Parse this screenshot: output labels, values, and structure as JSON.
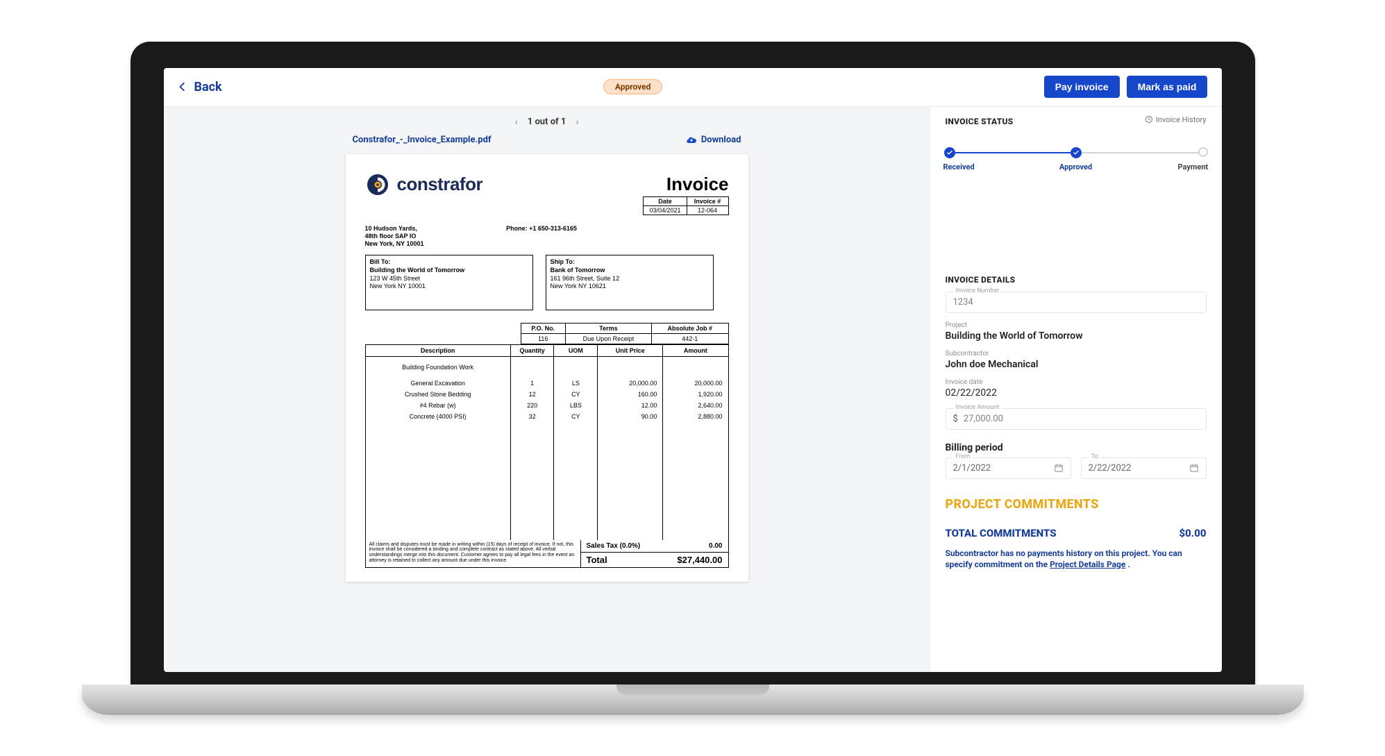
{
  "topbar": {
    "back_label": "Back",
    "status_pill": "Approved",
    "pay_label": "Pay invoice",
    "mark_paid_label": "Mark as paid"
  },
  "viewer": {
    "page_indicator": "1 out of 1",
    "file_name": "Constrafor_-_Invoice_Example.pdf",
    "download_label": "Download"
  },
  "invoice_doc": {
    "brand_name": "constrafor",
    "title": "Invoice",
    "meta": {
      "date_h": "Date",
      "invno_h": "Invoice #",
      "date": "03/04/2021",
      "invno": "12-064"
    },
    "company": {
      "line1": "10 Hudson Yards,",
      "line2": "48th floor SAP IO",
      "line3": "New York, NY 10001",
      "phone_label": "Phone: +1 650-313-6165"
    },
    "bill_to": {
      "h": "Bill To:",
      "line1": "Building the World of Tomorrow",
      "line2": "123 W 45th Street",
      "line3": "New York NY 10001"
    },
    "ship_to": {
      "h": "Ship To:",
      "line1": "Bank of Tomorrow",
      "line2": "161 96th Street, Suite 12",
      "line3": "New York NY 10621"
    },
    "po": {
      "po_h": "P.O. No.",
      "terms_h": "Terms",
      "job_h": "Absolute Job #",
      "po": "116",
      "terms": "Due Upon Receipt",
      "job": "442-1"
    },
    "cols": {
      "desc": "Description",
      "qty": "Quantity",
      "uom": "UOM",
      "unit": "Unit Price",
      "amount": "Amount"
    },
    "heading_line": "Building Foundation Work",
    "lines": [
      {
        "desc": "General Excavation",
        "qty": "1",
        "uom": "LS",
        "unit": "20,000.00",
        "amount": "20,000.00"
      },
      {
        "desc": "Crushed Stone Bedding",
        "qty": "12",
        "uom": "CY",
        "unit": "160.00",
        "amount": "1,920.00"
      },
      {
        "desc": "#4 Rebar (w)",
        "qty": "220",
        "uom": "LBS",
        "unit": "12.00",
        "amount": "2,640.00"
      },
      {
        "desc": "Concrete (4000 PSI)",
        "qty": "32",
        "uom": "CY",
        "unit": "90.00",
        "amount": "2,880.00"
      }
    ],
    "disclaimer": "All claims and disputes must be made in writing within (15) days of receipt of invoice. If not, this invoice shall be considered a binding and complete contract as stated above. All verbal understandings merge into this document. Customer agrees to pay all legal fees in the event an attorney is retained to collect any amount due under this invoice.",
    "tax_label": "Sales Tax (0.0%)",
    "tax_value": "0.00",
    "total_label": "Total",
    "total_value": "$27,440.00"
  },
  "status": {
    "heading": "INVOICE STATUS",
    "history_label": "Invoice History",
    "steps": {
      "received": "Received",
      "approved": "Approved",
      "payment": "Payment"
    }
  },
  "details": {
    "heading": "INVOICE DETAILS",
    "invno_label": "Invoice Number",
    "invno": "1234",
    "project_label": "Project",
    "project": "Building the World of Tomorrow",
    "sub_label": "Subcontractor",
    "sub": "John doe Mechanical",
    "date_label": "Invoice date",
    "date": "02/22/2022",
    "amount_label": "Invoice Amount",
    "amount": "27,000.00",
    "billing_h": "Billing period",
    "from_label": "From",
    "from": "2/1/2022",
    "to_label": "To",
    "to": "2/22/2022"
  },
  "commitments": {
    "heading": "PROJECT COMMITMENTS",
    "total_label": "TOTAL COMMITMENTS",
    "total_value": "$0.00",
    "note_pre": "Subcontractor has no payments history on this project. You can specify commitment on the ",
    "note_link": "Project Details Page",
    "note_post": " ."
  }
}
